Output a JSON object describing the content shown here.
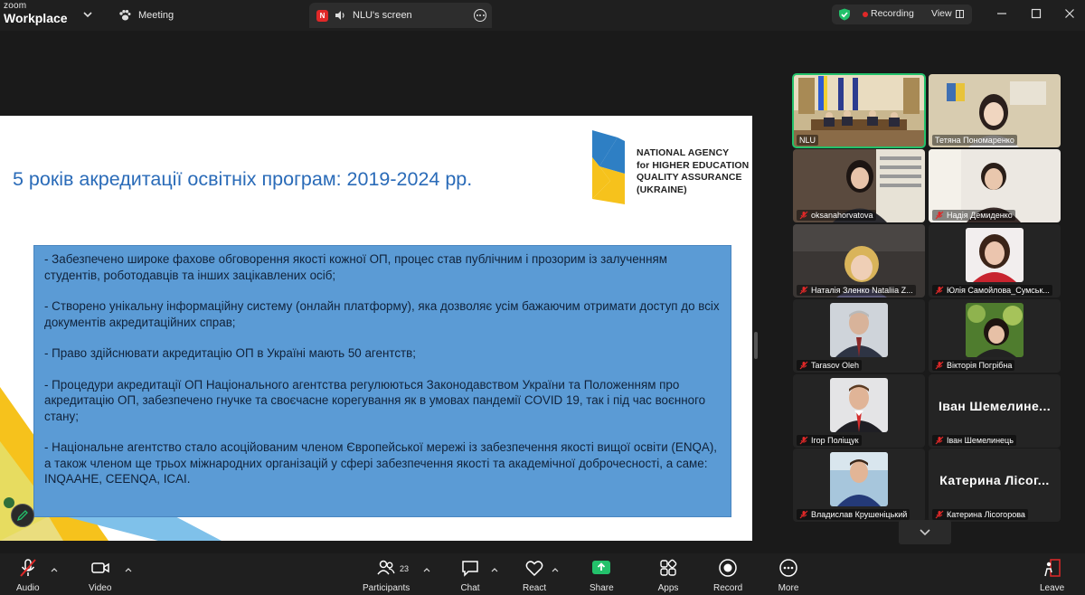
{
  "app": {
    "logo_line1": "zoom",
    "logo_line2": "Workplace"
  },
  "header": {
    "meeting_label": "Meeting",
    "share_tab_badge": "N",
    "share_tab_label": "NLU's screen",
    "recording_label": "Recording",
    "view_label": "View"
  },
  "slide": {
    "title": "5 років акредитації освітніх програм: 2019-2024 рр.",
    "agency": [
      "NATIONAL AGENCY",
      "for HIGHER EDUCATION",
      "QUALITY ASSURANCE",
      "(UKRAINE)"
    ],
    "paragraphs": [
      "  - Забезпечено широке фахове обговорення якості кожної ОП, процес став публічним і  прозорим із залученням студентів, роботодавців та інших зацікавлених осіб;",
      "  - Створено унікальну інформаційну систему (онлайн платформу), яка дозволяє усім бажаючим отримати доступ до всіх документів акредитаційних справ;",
      "  - Право здійснювати акредитацію ОП в Україні мають 50 агентств;",
      "  - Процедури акредитації ОП Національного агентства регулюються Законодавством України та Положенням про акредитацію ОП, забезпечено гнучке та своєчасне корегування як в умовах пандемії COVID 19, так і під час воєнного стану;",
      "  - Національне агентство стало асоційованим членом Європейської мережі із забезпечення якості вищої освіти (ENQA), а також членом ще трьох міжнародних організацій у сфері забезпечення якості та академічної доброчесності, а саме: INQAAHE, CEENQA, ICAI."
    ]
  },
  "participants": [
    {
      "name": "NLU",
      "muted": false,
      "active": true,
      "video": "room"
    },
    {
      "name": "Тетяна Пономаренко",
      "muted": false,
      "active": false,
      "video": "woman-office"
    },
    {
      "name": "oksanahorvatova",
      "muted": true,
      "active": false,
      "video": "woman-dark"
    },
    {
      "name": "Надія Демиденко",
      "muted": true,
      "active": false,
      "video": "woman-light"
    },
    {
      "name": "Наталія Зленко Nataliia Z...",
      "muted": true,
      "active": false,
      "video": "woman-blonde"
    },
    {
      "name": "Юлія Самойлова_Сумськ...",
      "muted": true,
      "active": false,
      "video": "avatar-woman"
    },
    {
      "name": "Tarasov Oleh",
      "muted": true,
      "active": false,
      "video": "avatar-man-grey"
    },
    {
      "name": "Вікторія Погрібна",
      "muted": true,
      "active": false,
      "video": "avatar-woman-green"
    },
    {
      "name": "Ігор Поліщук",
      "muted": true,
      "active": false,
      "video": "avatar-man-red"
    },
    {
      "name": "Іван Шемелинець",
      "muted": true,
      "active": false,
      "video": "none",
      "big_name": "Іван  Шемелине..."
    },
    {
      "name": "Владислав Крушеніцький",
      "muted": true,
      "active": false,
      "video": "avatar-man-blue"
    },
    {
      "name": "Катерина Лісогорова",
      "muted": true,
      "active": false,
      "video": "none",
      "big_name": "Катерина  Лісог..."
    }
  ],
  "toolbar": {
    "audio": "Audio",
    "video": "Video",
    "participants": "Participants",
    "participants_count": "23",
    "chat": "Chat",
    "react": "React",
    "share": "Share",
    "apps": "Apps",
    "record": "Record",
    "more": "More",
    "leave": "Leave"
  },
  "colors": {
    "accent_green": "#23c16b",
    "record_red": "#e02828",
    "slide_title_blue": "#2a6bb8",
    "slide_box_blue": "#5b9bd5",
    "logo_blue": "#2e7fc4",
    "logo_yellow": "#f6c21c"
  }
}
